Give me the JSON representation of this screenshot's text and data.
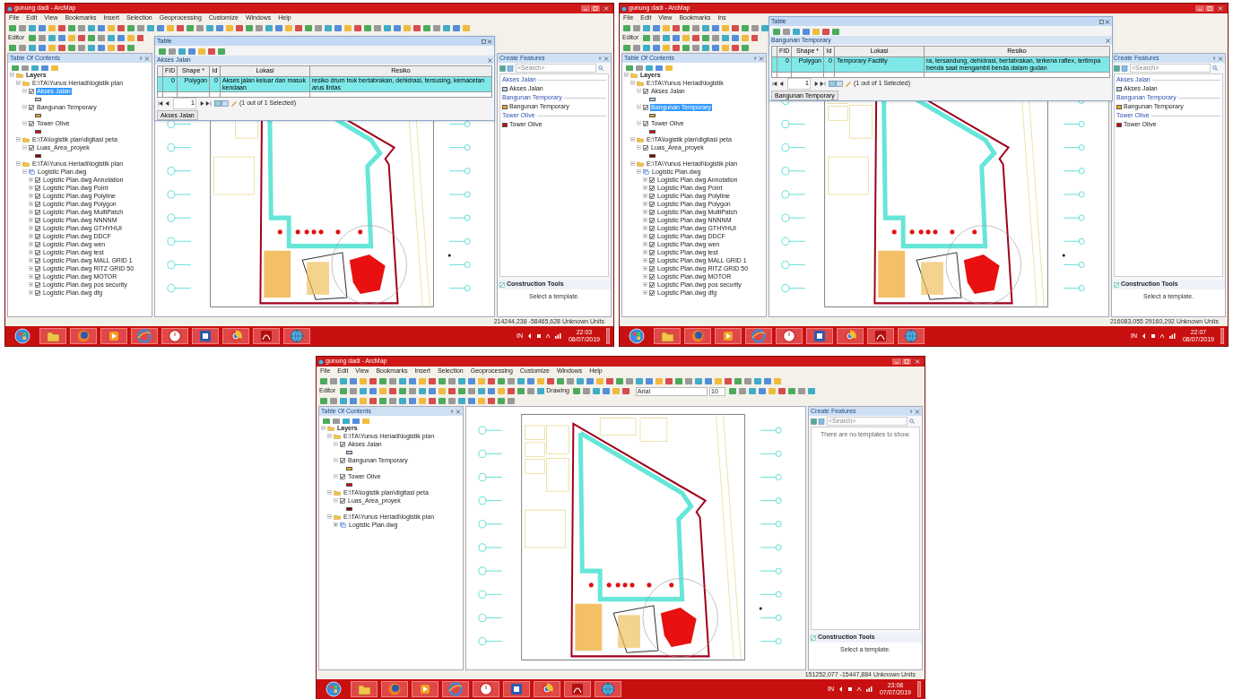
{
  "screens": [
    {
      "title": "gunung dadi - ArcMap",
      "menu": [
        "File",
        "Edit",
        "View",
        "Bookmarks",
        "Insert",
        "Selection",
        "Geoprocessing",
        "Customize",
        "Windows",
        "Help"
      ],
      "editor": "Editor",
      "toc": {
        "title": "Table Of Contents",
        "items": [
          {
            "kind": "group",
            "label": "Layers",
            "expanded": true,
            "selected": false,
            "children": [
              {
                "kind": "group",
                "label": "E:\\TA\\Yunus Heriadi\\logistik plan",
                "expanded": true,
                "selected": false,
                "children": [
                  {
                    "kind": "layer",
                    "label": "Akses Jalan",
                    "checked": true,
                    "selected": true,
                    "color": "#b8d4e8"
                  },
                  {
                    "kind": "layer",
                    "label": "Bangunan Temporary",
                    "checked": true,
                    "selected": false,
                    "color": "#f5a623"
                  },
                  {
                    "kind": "layer",
                    "label": "Tower Olive",
                    "checked": true,
                    "selected": false,
                    "color": "#e00000"
                  }
                ]
              },
              {
                "kind": "group",
                "label": "E:\\TA\\logistik plan\\digitasi peta",
                "expanded": true,
                "selected": false,
                "children": [
                  {
                    "kind": "layer",
                    "label": "Luas_Area_proyek",
                    "checked": true,
                    "selected": false,
                    "color": "#8b0000"
                  }
                ]
              },
              {
                "kind": "group",
                "label": "E:\\TA\\Yunus Heriadi\\logistik plan",
                "expanded": true,
                "selected": false,
                "children": [
                  {
                    "kind": "dataset",
                    "label": "Logistic Plan.dwg",
                    "expanded": true,
                    "selected": false,
                    "children": [
                      {
                        "kind": "sublayer",
                        "label": "Logistic Plan.dwg Annotation",
                        "checked": true,
                        "selected": false
                      },
                      {
                        "kind": "sublayer",
                        "label": "Logistic Plan.dwg Point",
                        "checked": true,
                        "selected": false
                      },
                      {
                        "kind": "sublayer",
                        "label": "Logistic Plan.dwg Polyline",
                        "checked": true,
                        "selected": false
                      },
                      {
                        "kind": "sublayer",
                        "label": "Logistic Plan.dwg Polygon",
                        "checked": true,
                        "selected": false
                      },
                      {
                        "kind": "sublayer",
                        "label": "Logistic Plan.dwg MultiPatch",
                        "checked": true,
                        "selected": false
                      },
                      {
                        "kind": "sublayer",
                        "label": "Logistic Plan.dwg NNNNM",
                        "checked": true,
                        "selected": false
                      },
                      {
                        "kind": "sublayer",
                        "label": "Logistic Plan.dwg GTHYHUI",
                        "checked": true,
                        "selected": false
                      },
                      {
                        "kind": "sublayer",
                        "label": "Logistic Plan.dwg DDCF",
                        "checked": true,
                        "selected": false
                      },
                      {
                        "kind": "sublayer",
                        "label": "Logistic Plan.dwg wen",
                        "checked": true,
                        "selected": false
                      },
                      {
                        "kind": "sublayer",
                        "label": "Logistic Plan.dwg test",
                        "checked": true,
                        "selected": false
                      },
                      {
                        "kind": "sublayer",
                        "label": "Logistic Plan.dwg MALL GRID 1",
                        "checked": true,
                        "selected": false
                      },
                      {
                        "kind": "sublayer",
                        "label": "Logistic Plan.dwg RITZ GRID 50",
                        "checked": true,
                        "selected": false
                      },
                      {
                        "kind": "sublayer",
                        "label": "Logistic Plan.dwg MOTOR",
                        "checked": true,
                        "selected": false
                      },
                      {
                        "kind": "sublayer",
                        "label": "Logistic Plan.dwg pos security",
                        "checked": true,
                        "selected": false
                      },
                      {
                        "kind": "sublayer",
                        "label": "Logistic Plan.dwg dfg",
                        "checked": true,
                        "selected": false
                      }
                    ]
                  }
                ]
              }
            ]
          }
        ]
      },
      "table": {
        "title": "Table",
        "tab_title": "Akses Jalan",
        "columns": [
          "FID",
          "Shape *",
          "Id",
          "Lokasi",
          "Resiko"
        ],
        "rows": [
          {
            "cells": [
              "0",
              "Polygon",
              "0",
              "Akses jalan keluar dan masuk kendaan",
              "resiko drum truk bertabrakan, dehidrasi, tersusing, kemacetan arus lintas"
            ],
            "selected": true
          }
        ],
        "record": "1",
        "selection": "(1 out of 1 Selected)",
        "bottom_tab": "Akses Jalan"
      },
      "create_features": {
        "title": "Create Features",
        "search_placeholder": "<Search>",
        "groups": [
          {
            "heading": "Akses Jalan",
            "templates": [
              {
                "label": "Akses Jalan",
                "color": "#b8d4e8"
              }
            ]
          },
          {
            "heading": "Bangunan Temporary",
            "templates": [
              {
                "label": "Bangunan Temporary",
                "color": "#f5a623"
              }
            ]
          },
          {
            "heading": "Tower Olive",
            "templates": [
              {
                "label": "Tower Olive",
                "color": "#d00000"
              }
            ]
          }
        ]
      },
      "construction_tools": {
        "title": "Construction Tools",
        "message": "Select a template."
      },
      "coordinates": "214244,238 -58465,628 Unknown Units",
      "taskbar": {
        "language": "IN",
        "time": "22:03",
        "date": "08/07/2019"
      }
    },
    {
      "title": "gunung dadi - ArcMap",
      "menu": [
        "File",
        "Edit",
        "View",
        "Bookmarks",
        "Ins"
      ],
      "editor": "Editor",
      "toc": {
        "title": "Table Of Contents",
        "items": [
          {
            "kind": "group",
            "label": "Layers",
            "expanded": true,
            "selected": false,
            "children": [
              {
                "kind": "group",
                "label": "E:\\TA\\Yunus Heriadi\\logistik",
                "expanded": true,
                "selected": false,
                "children": [
                  {
                    "kind": "layer",
                    "label": "Akses Jalan",
                    "checked": true,
                    "selected": false,
                    "color": "#b8d4e8"
                  },
                  {
                    "kind": "layer",
                    "label": "Bangunan Temporary",
                    "checked": true,
                    "selected": true,
                    "color": "#f5a623"
                  },
                  {
                    "kind": "layer",
                    "label": "Tower Olive",
                    "checked": true,
                    "selected": false,
                    "color": "#e00000"
                  }
                ]
              },
              {
                "kind": "group",
                "label": "E:\\TA\\logistik plan\\digitasi peta",
                "expanded": true,
                "selected": false,
                "children": [
                  {
                    "kind": "layer",
                    "label": "Luas_Area_proyek",
                    "checked": true,
                    "selected": false,
                    "color": "#8b0000"
                  }
                ]
              },
              {
                "kind": "group",
                "label": "E:\\TA\\Yunus Heriadi\\logistik plan",
                "expanded": true,
                "selected": false,
                "children": [
                  {
                    "kind": "dataset",
                    "label": "Logistic Plan.dwg",
                    "expanded": true,
                    "selected": false,
                    "children": [
                      {
                        "kind": "sublayer",
                        "label": "Logistic Plan.dwg Annotation",
                        "checked": true,
                        "selected": false
                      },
                      {
                        "kind": "sublayer",
                        "label": "Logistic Plan.dwg Point",
                        "checked": true,
                        "selected": false
                      },
                      {
                        "kind": "sublayer",
                        "label": "Logistic Plan.dwg Polyline",
                        "checked": true,
                        "selected": false
                      },
                      {
                        "kind": "sublayer",
                        "label": "Logistic Plan.dwg Polygon",
                        "checked": true,
                        "selected": false
                      },
                      {
                        "kind": "sublayer",
                        "label": "Logistic Plan.dwg MultiPatch",
                        "checked": true,
                        "selected": false
                      },
                      {
                        "kind": "sublayer",
                        "label": "Logistic Plan.dwg NNNNM",
                        "checked": true,
                        "selected": false
                      },
                      {
                        "kind": "sublayer",
                        "label": "Logistic Plan.dwg GTHYHUI",
                        "checked": true,
                        "selected": false
                      },
                      {
                        "kind": "sublayer",
                        "label": "Logistic Plan.dwg DDCF",
                        "checked": true,
                        "selected": false
                      },
                      {
                        "kind": "sublayer",
                        "label": "Logistic Plan.dwg wen",
                        "checked": true,
                        "selected": false
                      },
                      {
                        "kind": "sublayer",
                        "label": "Logistic Plan.dwg test",
                        "checked": true,
                        "selected": false
                      },
                      {
                        "kind": "sublayer",
                        "label": "Logistic Plan.dwg MALL GRID 1",
                        "checked": true,
                        "selected": false
                      },
                      {
                        "kind": "sublayer",
                        "label": "Logistic Plan.dwg RITZ GRID 50",
                        "checked": true,
                        "selected": false
                      },
                      {
                        "kind": "sublayer",
                        "label": "Logistic Plan.dwg MOTOR",
                        "checked": true,
                        "selected": false
                      },
                      {
                        "kind": "sublayer",
                        "label": "Logistic Plan.dwg pos security",
                        "checked": true,
                        "selected": false
                      },
                      {
                        "kind": "sublayer",
                        "label": "Logistic Plan.dwg dfg",
                        "checked": true,
                        "selected": false
                      }
                    ]
                  }
                ]
              }
            ]
          }
        ]
      },
      "table": {
        "title": "Table",
        "tab_title": "Bangunan Temporary",
        "columns": [
          "FID",
          "Shape *",
          "Id",
          "Lokasi",
          "Resiko"
        ],
        "rows": [
          {
            "cells": [
              "0",
              "Polygon",
              "0",
              "Temporary Facility",
              "ra, tersandung, dehidrasi, bertabrakan, terkena raflex, tertimpa benda saat mengambil benda dalam gudan"
            ],
            "selected": true
          }
        ],
        "record": "1",
        "selection": "(1 out of 1 Selected)",
        "bottom_tab": "Bangunan Temporary"
      },
      "create_features": {
        "title": "Create Features",
        "search_placeholder": "<Search>",
        "groups": [
          {
            "heading": "Akses Jalan",
            "templates": [
              {
                "label": "Akses Jalan",
                "color": "#b8d4e8"
              }
            ]
          },
          {
            "heading": "Bangunan Temporary",
            "templates": [
              {
                "label": "Bangunan Temporary",
                "color": "#f5a623"
              }
            ]
          },
          {
            "heading": "Tower Olive",
            "templates": [
              {
                "label": "Tower Olive",
                "color": "#d00000"
              }
            ]
          }
        ]
      },
      "construction_tools": {
        "title": "Construction Tools",
        "message": "Select a template."
      },
      "coordinates": "216083,055 29160,292 Unknown Units",
      "taskbar": {
        "language": "IN",
        "time": "22:07",
        "date": "08/07/2019"
      }
    },
    {
      "title": "gunung dadi - ArcMap",
      "menu": [
        "File",
        "Edit",
        "View",
        "Bookmarks",
        "Insert",
        "Selection",
        "Geoprocessing",
        "Customize",
        "Windows",
        "Help"
      ],
      "editor": "Editor",
      "drawing_toolbar": {
        "label": "Drawing",
        "font": "Arial",
        "size": "10"
      },
      "toc": {
        "title": "Table Of Contents",
        "items": [
          {
            "kind": "group",
            "label": "Layers",
            "expanded": true,
            "selected": false,
            "children": [
              {
                "kind": "group",
                "label": "E:\\TA\\Yunus Heriadi\\logistik plan",
                "expanded": true,
                "selected": false,
                "children": [
                  {
                    "kind": "layer",
                    "label": "Akses Jalan",
                    "checked": true,
                    "selected": false,
                    "color": "#b8d4e8"
                  },
                  {
                    "kind": "layer",
                    "label": "Bangunan Temporary",
                    "checked": true,
                    "selected": false,
                    "color": "#f5a623"
                  },
                  {
                    "kind": "layer",
                    "label": "Tower Olive",
                    "checked": true,
                    "selected": false,
                    "color": "#e00000"
                  }
                ]
              },
              {
                "kind": "group",
                "label": "E:\\TA\\logistik plan\\digitasi peta",
                "expanded": true,
                "selected": false,
                "children": [
                  {
                    "kind": "layer",
                    "label": "Luas_Area_proyek",
                    "checked": true,
                    "selected": false,
                    "color": "#8b0000"
                  }
                ]
              },
              {
                "kind": "group",
                "label": "E:\\TA\\Yunus Heriadi\\logistik plan",
                "expanded": true,
                "selected": false,
                "children": [
                  {
                    "kind": "dataset",
                    "label": "Logistic Plan.dwg",
                    "expanded": false,
                    "selected": false
                  }
                ]
              }
            ]
          }
        ]
      },
      "create_features": {
        "title": "Create Features",
        "search_placeholder": "<Search>",
        "empty_message": "There are no templates to show."
      },
      "construction_tools": {
        "title": "Construction Tools",
        "message": "Select a template."
      },
      "coordinates": "151252,077 -15447,884 Unknown Units",
      "taskbar": {
        "language": "IN",
        "time": "23:08",
        "date": "07/07/2019"
      }
    }
  ]
}
